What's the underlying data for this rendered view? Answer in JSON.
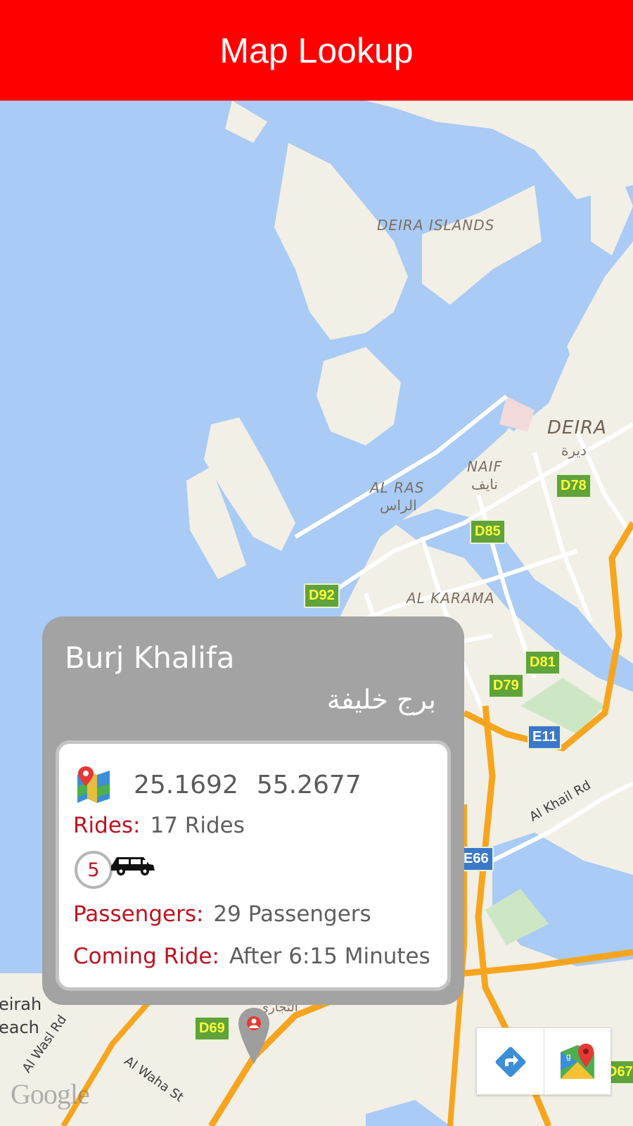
{
  "header": {
    "title": "Map Lookup"
  },
  "map": {
    "labels": {
      "deira_islands": "DEIRA ISLANDS",
      "deira": "DEIRA",
      "deira_ar": "ديرة",
      "naif": "NAIF",
      "naif_ar": "نايف",
      "al_ras": "AL RAS",
      "al_ras_ar": "الراس",
      "al_karama": "AL KARAMA",
      "jumeirah": "eirah",
      "beach": "each",
      "tijari_ar": "التجاري",
      "al_khail_rd": "Al Khail Rd",
      "al_wasl_rd": "Al Wasl Rd",
      "al_waha_st": "Al Waha St"
    },
    "shields": {
      "d78": "D78",
      "d85": "D85",
      "d92": "D92",
      "d81": "D81",
      "d79": "D79",
      "e11": "E11",
      "e66": "E66",
      "d69": "D69",
      "d67": "D67"
    },
    "attribution": "Google",
    "colors": {
      "water": "#a9cbf5",
      "land": "#f2efe6",
      "highway": "#f7a51e"
    }
  },
  "card": {
    "title": "Burj Khalifa",
    "title_ar": "برج خليفة",
    "latitude": "25.1692",
    "longitude": "55.2677",
    "rides_label": "Rides:",
    "rides_value": "17 Rides",
    "seats": "5",
    "passengers_label": "Passengers:",
    "passengers_value": "29 Passengers",
    "coming_label": "Coming Ride:",
    "coming_value": "After 6:15 Minutes",
    "accent_color": "#c0111f"
  },
  "controls": {
    "directions_icon": "directions-icon",
    "google_maps_icon": "google-maps-icon"
  }
}
